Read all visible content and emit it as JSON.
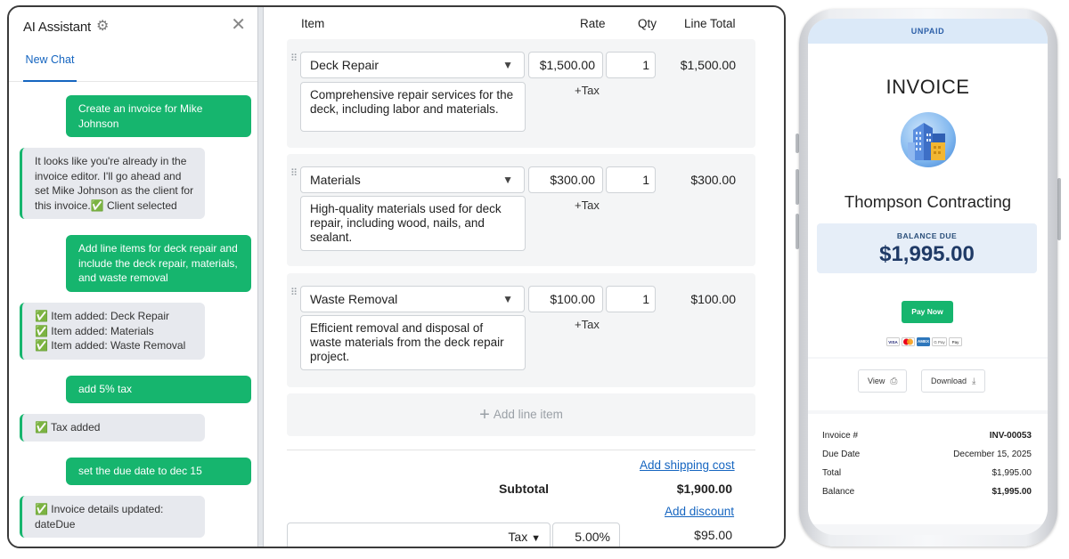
{
  "ai_panel": {
    "title": "AI Assistant",
    "tab": "New Chat",
    "messages": [
      {
        "role": "user",
        "text": "Create an invoice for Mike Johnson"
      },
      {
        "role": "assistant",
        "text": "It looks like you're already in the invoice editor. I'll go ahead and set Mike Johnson as the client for this invoice.✅ Client selected"
      },
      {
        "role": "user",
        "text": "Add line items for deck repair and include the deck repair, materials, and waste removal"
      },
      {
        "role": "assistant",
        "lines": [
          "✅ Item added: Deck Repair",
          "✅ Item added: Materials",
          "✅ Item added: Waste Removal"
        ]
      },
      {
        "role": "user",
        "text": "add 5% tax"
      },
      {
        "role": "assistant",
        "text": "✅ Tax added"
      },
      {
        "role": "user",
        "text": "set the due date to dec 15"
      },
      {
        "role": "assistant",
        "lines": [
          "✅ Invoice details updated:",
          "dateDue"
        ]
      }
    ]
  },
  "editor": {
    "columns": {
      "item": "Item",
      "rate": "Rate",
      "qty": "Qty",
      "line_total": "Line Total"
    },
    "items": [
      {
        "name": "Deck Repair",
        "rate": "$1,500.00",
        "qty": "1",
        "total": "$1,500.00",
        "tax_label": "+Tax",
        "description": "Comprehensive repair services for the deck, including labor and materials."
      },
      {
        "name": "Materials",
        "rate": "$300.00",
        "qty": "1",
        "total": "$300.00",
        "tax_label": "+Tax",
        "description": "High-quality materials used for deck repair, including wood, nails, and sealant."
      },
      {
        "name": "Waste Removal",
        "rate": "$100.00",
        "qty": "1",
        "total": "$100.00",
        "tax_label": "+Tax",
        "description": "Efficient removal and disposal of waste materials from the deck repair project."
      }
    ],
    "add_line_item": "Add line item",
    "add_shipping": "Add shipping cost",
    "subtotal_label": "Subtotal",
    "subtotal_value": "$1,900.00",
    "add_discount": "Add discount",
    "tax_select": "Tax",
    "tax_rate": "5.00%",
    "tax_value": "$95.00"
  },
  "preview": {
    "status": "UNPAID",
    "title": "INVOICE",
    "company": "Thompson Contracting",
    "balance_label": "BALANCE DUE",
    "balance_amount": "$1,995.00",
    "pay_button": "Pay Now",
    "payment_marks": [
      "VISA",
      "MC",
      "AMEX",
      "G Pay",
      "Pay"
    ],
    "view_button": "View",
    "download_button": "Download",
    "details": [
      {
        "label": "Invoice #",
        "value": "INV-00053"
      },
      {
        "label": "Due Date",
        "value": "December 15, 2025"
      },
      {
        "label": "Total",
        "value": "$1,995.00"
      },
      {
        "label": "Balance",
        "value": "$1,995.00"
      }
    ]
  },
  "colors": {
    "accent_green": "#16b56e",
    "link_blue": "#1565c0",
    "balance_navy": "#1f3a66"
  }
}
